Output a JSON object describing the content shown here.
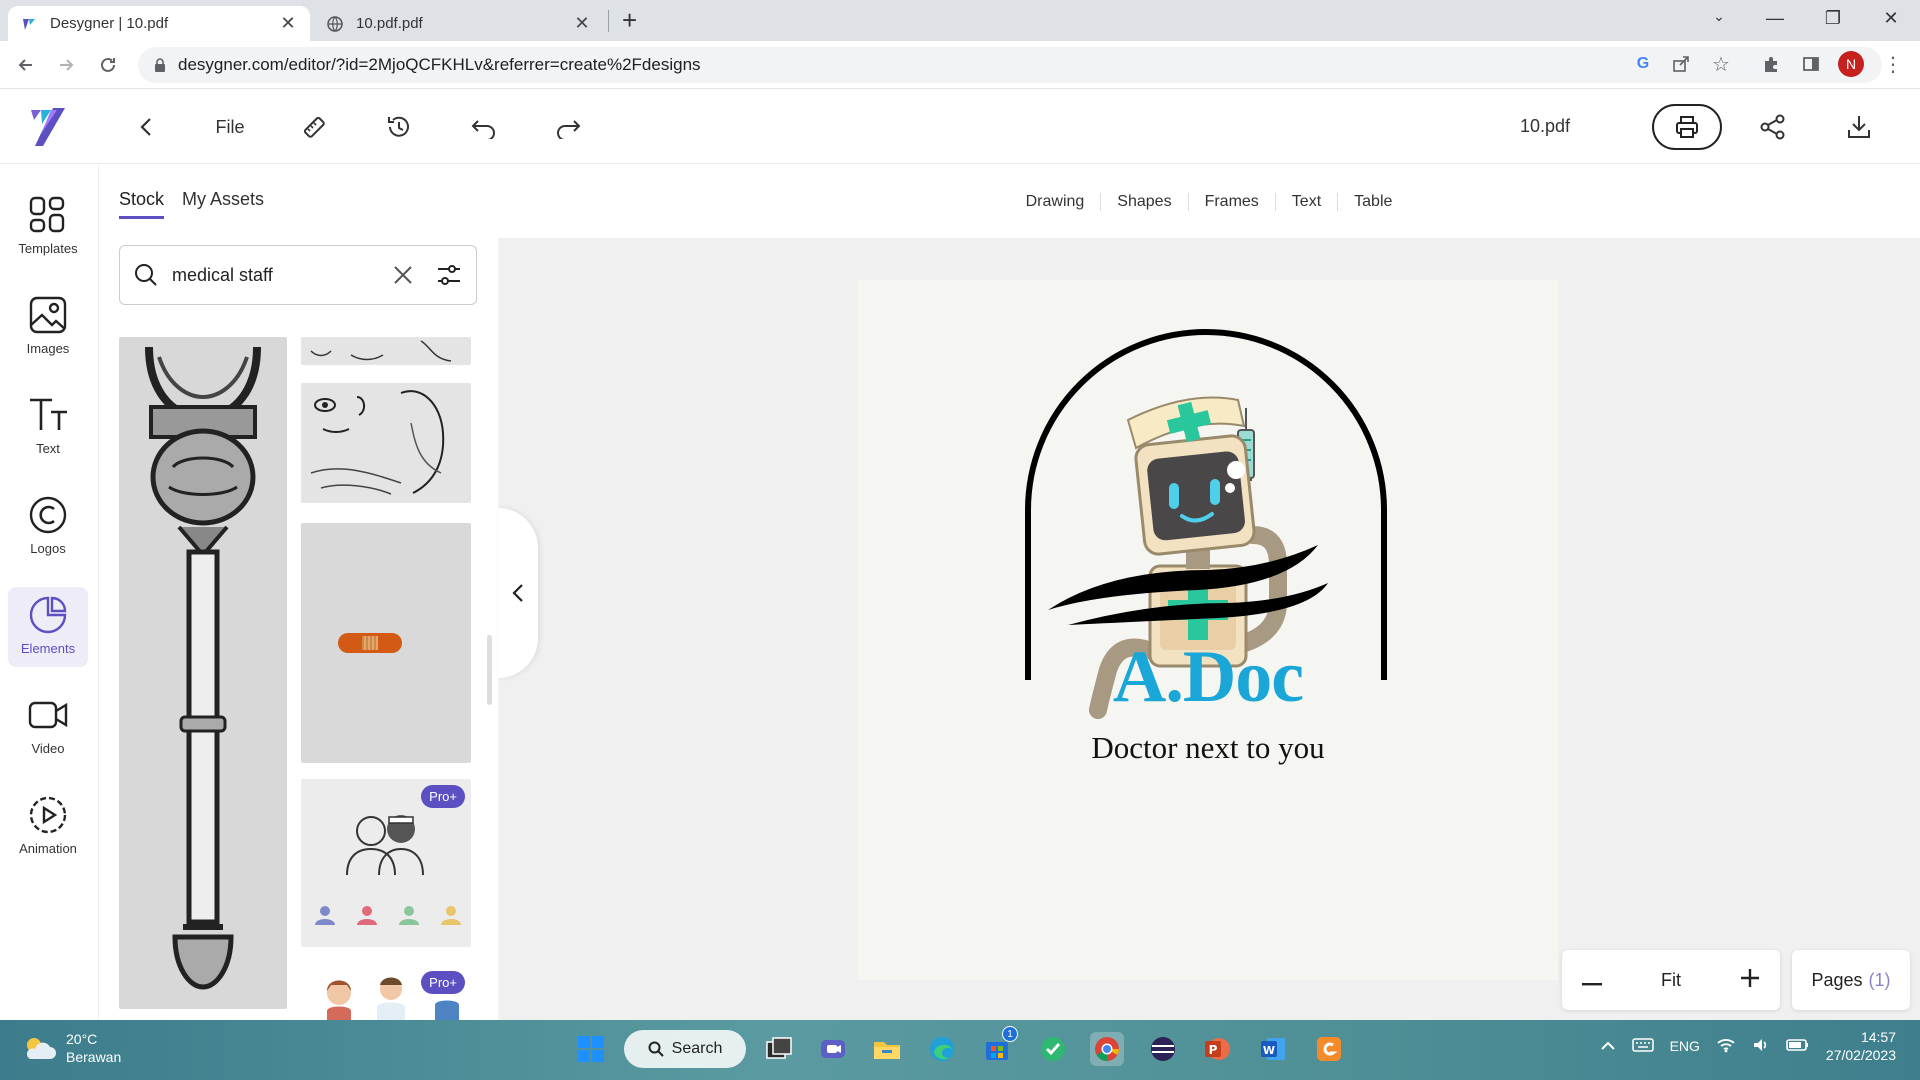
{
  "browser": {
    "tabs": [
      {
        "title": "Desygner | 10.pdf",
        "active": true
      },
      {
        "title": "10.pdf.pdf",
        "active": false
      }
    ],
    "url": "desygner.com/editor/?id=2MjoQCFKHLv&referrer=create%2Fdesigns",
    "profile_initial": "N"
  },
  "header": {
    "file_label": "File",
    "document_name": "10.pdf"
  },
  "rail": {
    "items": [
      {
        "label": "Templates"
      },
      {
        "label": "Images"
      },
      {
        "label": "Text"
      },
      {
        "label": "Logos"
      },
      {
        "label": "Elements",
        "active": true
      },
      {
        "label": "Video"
      },
      {
        "label": "Animation"
      }
    ]
  },
  "panel": {
    "tabs": [
      "Stock",
      "My Assets"
    ],
    "search_value": "medical staff",
    "pro_badge": "Pro+"
  },
  "toolbar": {
    "items": [
      "Drawing",
      "Shapes",
      "Frames",
      "Text",
      "Table"
    ]
  },
  "design": {
    "title": "A.Doc",
    "subtitle": "Doctor next to you"
  },
  "zoom": {
    "fit_label": "Fit"
  },
  "pages": {
    "label": "Pages",
    "count": "(1)"
  },
  "taskbar": {
    "weather_temp": "20°C",
    "weather_desc": "Berawan",
    "search_label": "Search",
    "lang": "ENG",
    "time": "14:57",
    "date": "27/02/2023",
    "store_badge": "1"
  },
  "colors": {
    "accent": "#5b4fc2",
    "brand_title": "#1aa6d6"
  }
}
